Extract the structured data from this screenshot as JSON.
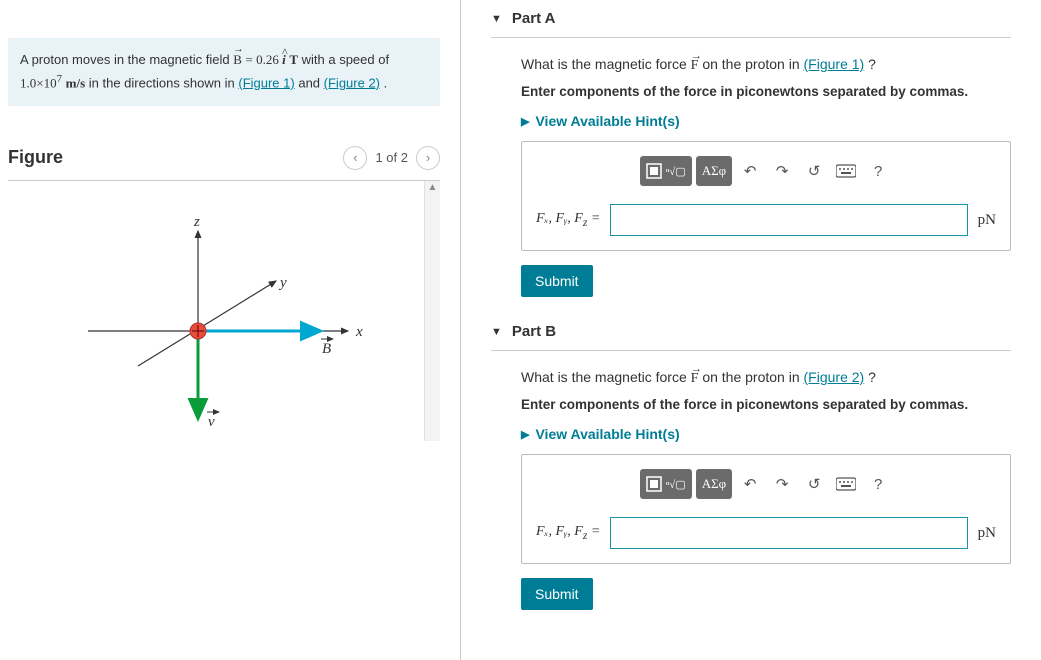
{
  "problem": {
    "text_prefix": "A proton moves in the magnetic field ",
    "B_expr": "B",
    "eq": " = 0.26 ",
    "ihat": "i",
    "units_T": " T",
    "with_speed": " with a speed of ",
    "speed": "1.0×10",
    "speed_exp": "7",
    "speed_units": " m/s",
    "dirs": " in the directions shown in ",
    "fig1": "(Figure 1)",
    "and": " and ",
    "fig2": "(Figure 2)",
    "dot": "."
  },
  "figure": {
    "title": "Figure",
    "pager": "1 of 2",
    "labels": {
      "x": "x",
      "y": "y",
      "z": "z",
      "B": "B",
      "v": "v"
    }
  },
  "parts": {
    "A": {
      "title": "Part A",
      "q_prefix": "What is the magnetic force ",
      "F": "F",
      "q_mid": " on the proton in ",
      "link": "(Figure 1)",
      "q_suffix": "?",
      "instr": "Enter components of the force in piconewtons separated by commas.",
      "hint": "View Available Hint(s)",
      "toolbar": {
        "asf": "ΑΣφ"
      },
      "label": "Fₓ, Fᵧ, F",
      "label_sub": "z",
      "label_eq": " = ",
      "unit": "pN",
      "submit": "Submit"
    },
    "B": {
      "title": "Part B",
      "q_prefix": "What is the magnetic force ",
      "F": "F",
      "q_mid": " on the proton in ",
      "link": "(Figure 2)",
      "q_suffix": "?",
      "instr": "Enter components of the force in piconewtons separated by commas.",
      "hint": "View Available Hint(s)",
      "toolbar": {
        "asf": "ΑΣφ"
      },
      "label": "Fₓ, Fᵧ, F",
      "label_sub": "z",
      "label_eq": " = ",
      "unit": "pN",
      "submit": "Submit"
    }
  },
  "icons": {
    "help": "?"
  }
}
